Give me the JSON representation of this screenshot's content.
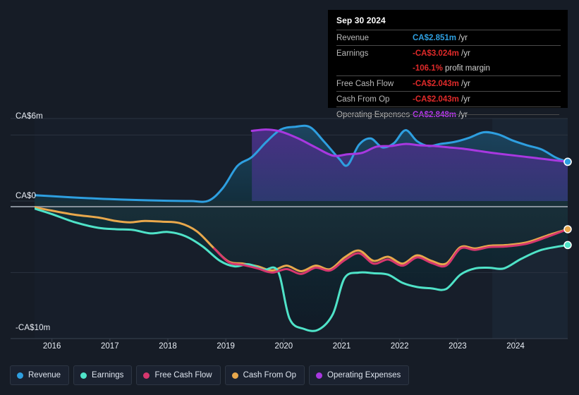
{
  "theme": {
    "background": "#161c26",
    "plot_background": "#171e2a",
    "grid_color": "#2b3340",
    "zero_line_color": "#9aa3ad",
    "axis_text": "#e9eef5"
  },
  "tooltip": {
    "date": "Sep 30 2024",
    "rows": [
      {
        "label": "Revenue",
        "value": "CA$2.851m",
        "unit": "/yr",
        "color": "#2e9fe0"
      },
      {
        "label": "Earnings",
        "value": "-CA$3.024m",
        "unit": "/yr",
        "color": "#e02a2a"
      },
      {
        "label": "",
        "value": "-106.1%",
        "unit": "profit margin",
        "color": "#e02a2a"
      },
      {
        "label": "Free Cash Flow",
        "value": "-CA$2.043m",
        "unit": "/yr",
        "color": "#e02a2a"
      },
      {
        "label": "Cash From Op",
        "value": "-CA$2.043m",
        "unit": "/yr",
        "color": "#e02a2a"
      },
      {
        "label": "Operating Expenses",
        "value": "CA$2.848m",
        "unit": "/yr",
        "color": "#b338e8"
      }
    ]
  },
  "legend": {
    "items": [
      {
        "label": "Revenue",
        "color": "#2e9fe0"
      },
      {
        "label": "Earnings",
        "color": "#4fe3c8"
      },
      {
        "label": "Free Cash Flow",
        "color": "#d6376e"
      },
      {
        "label": "Cash From Op",
        "color": "#e8a84c"
      },
      {
        "label": "Operating Expenses",
        "color": "#a838e0"
      }
    ]
  },
  "chart_data": {
    "type": "area",
    "title": "",
    "xlabel": "",
    "ylabel": "",
    "grid": true,
    "legend_position": "bottom",
    "ylim": [
      -10,
      6
    ],
    "ytick_labels": [
      "CA$6m",
      "CA$0",
      "-CA$10m"
    ],
    "ytick_values": [
      6,
      0,
      -10
    ],
    "gridline_values": [
      6,
      4.8,
      0,
      -5.2,
      -10
    ],
    "xlim": [
      2015.7,
      2024.9
    ],
    "categories": [
      2016,
      2017,
      2018,
      2019,
      2020,
      2021,
      2022,
      2023,
      2024
    ],
    "xtick_labels": [
      "2016",
      "2017",
      "2018",
      "2019",
      "2020",
      "2021",
      "2022",
      "2023",
      "2024"
    ],
    "forecast_start": 2023.6,
    "series": [
      {
        "name": "Revenue",
        "color": "#2e9fe0",
        "fill": "#1b3a52",
        "x": [
          2015.7,
          2016.0,
          2016.5,
          2017.0,
          2017.5,
          2018.0,
          2018.4,
          2018.7,
          2018.95,
          2019.2,
          2019.45,
          2019.7,
          2019.95,
          2020.2,
          2020.45,
          2020.7,
          2020.95,
          2021.1,
          2021.3,
          2021.5,
          2021.7,
          2021.9,
          2022.1,
          2022.3,
          2022.5,
          2022.7,
          2022.95,
          2023.2,
          2023.45,
          2023.7,
          2023.95,
          2024.2,
          2024.45,
          2024.7,
          2024.9
        ],
        "y": [
          0.42,
          0.35,
          0.23,
          0.14,
          0.07,
          0.02,
          0.0,
          0.02,
          0.95,
          2.55,
          3.2,
          4.3,
          5.2,
          5.4,
          5.38,
          4.3,
          3.1,
          2.6,
          4.1,
          4.55,
          3.9,
          4.2,
          5.15,
          4.35,
          4.0,
          4.15,
          4.3,
          4.6,
          5.0,
          4.85,
          4.4,
          4.05,
          3.75,
          3.15,
          2.85
        ]
      },
      {
        "name": "Operating Expenses",
        "color": "#a838e0",
        "fill": "#3b2f72",
        "x": [
          2019.45,
          2019.7,
          2019.95,
          2020.25,
          2020.55,
          2020.85,
          2021.1,
          2021.35,
          2021.6,
          2021.85,
          2022.1,
          2022.35,
          2022.6,
          2022.85,
          2023.1,
          2023.35,
          2023.6,
          2023.9,
          2024.2,
          2024.5,
          2024.9
        ],
        "y": [
          5.1,
          5.2,
          5.05,
          4.55,
          3.9,
          3.3,
          3.4,
          3.5,
          3.95,
          4.0,
          4.15,
          4.05,
          4.0,
          3.9,
          3.8,
          3.65,
          3.5,
          3.35,
          3.2,
          3.05,
          2.85
        ]
      },
      {
        "name": "Earnings",
        "color": "#4fe3c8",
        "fill": "#0f2a33",
        "x": [
          2015.7,
          2016.0,
          2016.4,
          2016.8,
          2017.1,
          2017.4,
          2017.7,
          2018.0,
          2018.3,
          2018.6,
          2018.9,
          2019.15,
          2019.4,
          2019.65,
          2019.9,
          2020.1,
          2020.35,
          2020.6,
          2020.85,
          2021.05,
          2021.3,
          2021.55,
          2021.8,
          2022.05,
          2022.3,
          2022.55,
          2022.8,
          2023.05,
          2023.3,
          2023.55,
          2023.8,
          2024.1,
          2024.45,
          2024.9
        ],
        "y": [
          -0.55,
          -0.95,
          -1.55,
          -1.95,
          -2.05,
          -2.1,
          -2.35,
          -2.25,
          -2.55,
          -3.3,
          -4.35,
          -4.75,
          -4.6,
          -5.0,
          -5.1,
          -8.55,
          -9.3,
          -9.35,
          -8.2,
          -5.6,
          -5.2,
          -5.25,
          -5.35,
          -5.95,
          -6.25,
          -6.35,
          -6.4,
          -5.35,
          -4.9,
          -4.85,
          -4.9,
          -4.2,
          -3.55,
          -3.2
        ]
      },
      {
        "name": "Cash From Op",
        "color": "#e8a84c",
        "fill": "#5a2330",
        "x": [
          2015.7,
          2016.0,
          2016.4,
          2016.8,
          2017.1,
          2017.35,
          2017.6,
          2017.9,
          2018.2,
          2018.5,
          2018.8,
          2019.05,
          2019.3,
          2019.55,
          2019.8,
          2020.05,
          2020.3,
          2020.55,
          2020.8,
          2021.05,
          2021.3,
          2021.55,
          2021.8,
          2022.05,
          2022.3,
          2022.55,
          2022.8,
          2023.05,
          2023.3,
          2023.55,
          2023.85,
          2024.2,
          2024.55,
          2024.9
        ],
        "y": [
          -0.45,
          -0.7,
          -1.0,
          -1.2,
          -1.45,
          -1.55,
          -1.45,
          -1.5,
          -1.6,
          -2.2,
          -3.45,
          -4.4,
          -4.55,
          -4.75,
          -5.05,
          -4.7,
          -5.1,
          -4.7,
          -4.95,
          -4.1,
          -3.6,
          -4.35,
          -4.05,
          -4.55,
          -3.95,
          -4.35,
          -4.55,
          -3.35,
          -3.45,
          -3.25,
          -3.2,
          -3.0,
          -2.5,
          -2.05
        ]
      },
      {
        "name": "Free Cash Flow",
        "color": "#d6376e",
        "fill": "none",
        "x": [
          2018.8,
          2019.05,
          2019.3,
          2019.55,
          2019.8,
          2020.05,
          2020.3,
          2020.55,
          2020.8,
          2021.05,
          2021.3,
          2021.55,
          2021.8,
          2022.05,
          2022.3,
          2022.55,
          2022.8,
          2023.05,
          2023.3,
          2023.55,
          2023.85,
          2024.2,
          2024.55,
          2024.9
        ],
        "y": [
          -3.45,
          -4.45,
          -4.65,
          -4.9,
          -5.2,
          -4.95,
          -5.3,
          -4.85,
          -5.05,
          -4.3,
          -3.8,
          -4.55,
          -4.25,
          -4.7,
          -4.1,
          -4.5,
          -4.7,
          -3.45,
          -3.55,
          -3.35,
          -3.3,
          -3.1,
          -2.6,
          -2.05
        ]
      }
    ],
    "endpoints": [
      {
        "series": "Operating Expenses",
        "x": 2024.9,
        "y": 2.85,
        "color": "#a838e0"
      },
      {
        "series": "Revenue",
        "x": 2024.9,
        "y": 2.85,
        "color": "#2e9fe0"
      },
      {
        "series": "Cash From Op",
        "x": 2024.9,
        "y": -2.05,
        "color": "#e8a84c"
      },
      {
        "series": "Earnings",
        "x": 2024.9,
        "y": -3.2,
        "color": "#4fe3c8"
      }
    ]
  }
}
